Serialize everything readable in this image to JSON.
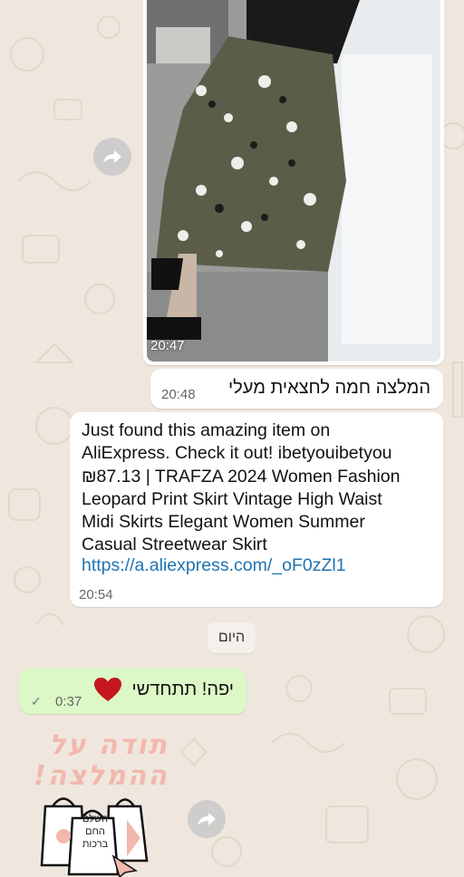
{
  "colors": {
    "wallpaper": "#efe7de",
    "bubble_in": "#ffffff",
    "bubble_out": "#dcf8c6",
    "link": "#1f73b0",
    "sticker_pink": "#f2b8ae"
  },
  "messages": {
    "photo_time": "20:47",
    "heb_text": "המלצה חמה לחצאית מעלי",
    "heb_time": "20:48",
    "link_text": "Just found this amazing item on\nAliExpress. Check it out! ibetyouibetyou\n₪87.13 | TRAFZA 2024 Women Fashion\nLeopard Print Skirt Vintage High Waist\nMidi Skirts Elegant Women Summer\nCasual Streetwear Skirt",
    "link_url": "https://a.aliexpress.com/_oF0zZl1",
    "link_time": "20:54",
    "day_label": "היום",
    "out_text": "יפה! תתחדשי",
    "out_time": "0:37"
  },
  "sticker": {
    "text": "תודה על ההמלצה!",
    "bag_text": "השלם החם ברכות"
  },
  "icons": {
    "forward": "forward-icon",
    "heart": "heart-emoji",
    "read": "double-check-icon"
  }
}
